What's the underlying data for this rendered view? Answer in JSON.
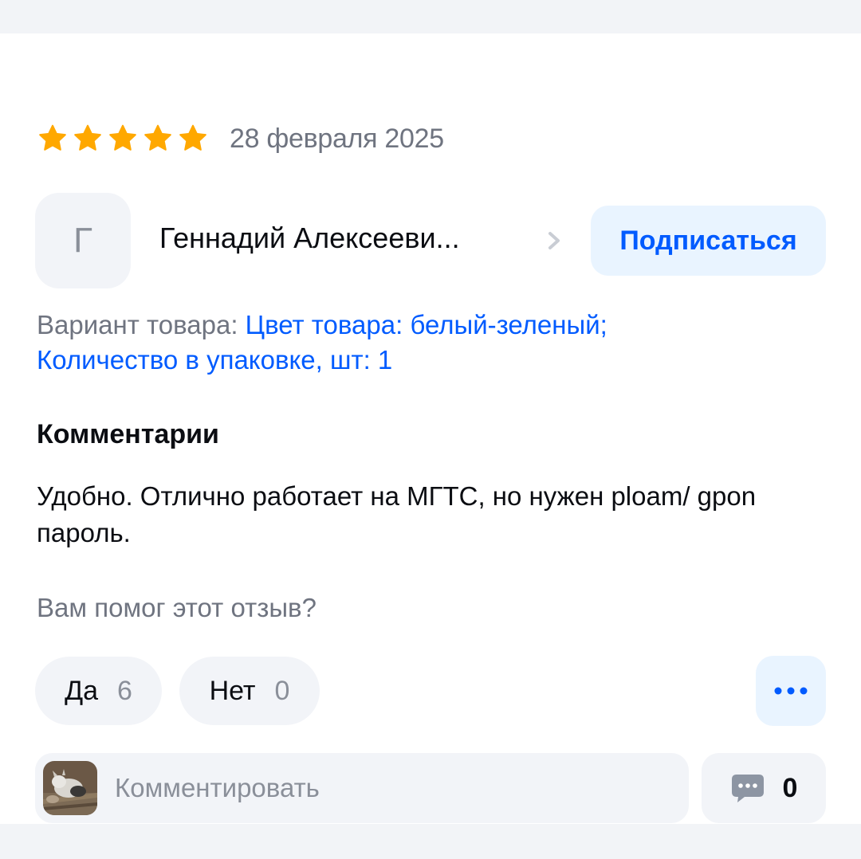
{
  "review": {
    "rating": 5,
    "rating_max": 5,
    "date": "28 февраля 2025",
    "author": {
      "initial": "Г",
      "name": "Геннадий Алексееви..."
    },
    "subscribe_label": "Подписаться",
    "variant": {
      "label": "Вариант товара:",
      "value_line1": "Цвет товара: белый-зеленый;",
      "value_line2": "Количество в упаковке, шт: 1"
    },
    "comments_heading": "Комментарии",
    "comment_text": "Удобно. Отлично работает на МГТС, но нужен ploam/ gpon пароль.",
    "helpful_question": "Вам помог этот отзыв?",
    "votes": {
      "yes_label": "Да",
      "yes_count": "6",
      "no_label": "Нет",
      "no_count": "0"
    },
    "comment_input_placeholder": "Комментировать",
    "comment_count": "0"
  },
  "icons": {
    "star": "star-icon",
    "chevron": "chevron-right-icon",
    "more": "more-dots-icon",
    "comment": "comment-bubble-icon"
  },
  "colors": {
    "accent": "#005bff",
    "accent_bg": "#e9f4ff",
    "star": "#ffa800",
    "muted_text": "#6f7480",
    "chip_bg": "#f2f4f8"
  }
}
